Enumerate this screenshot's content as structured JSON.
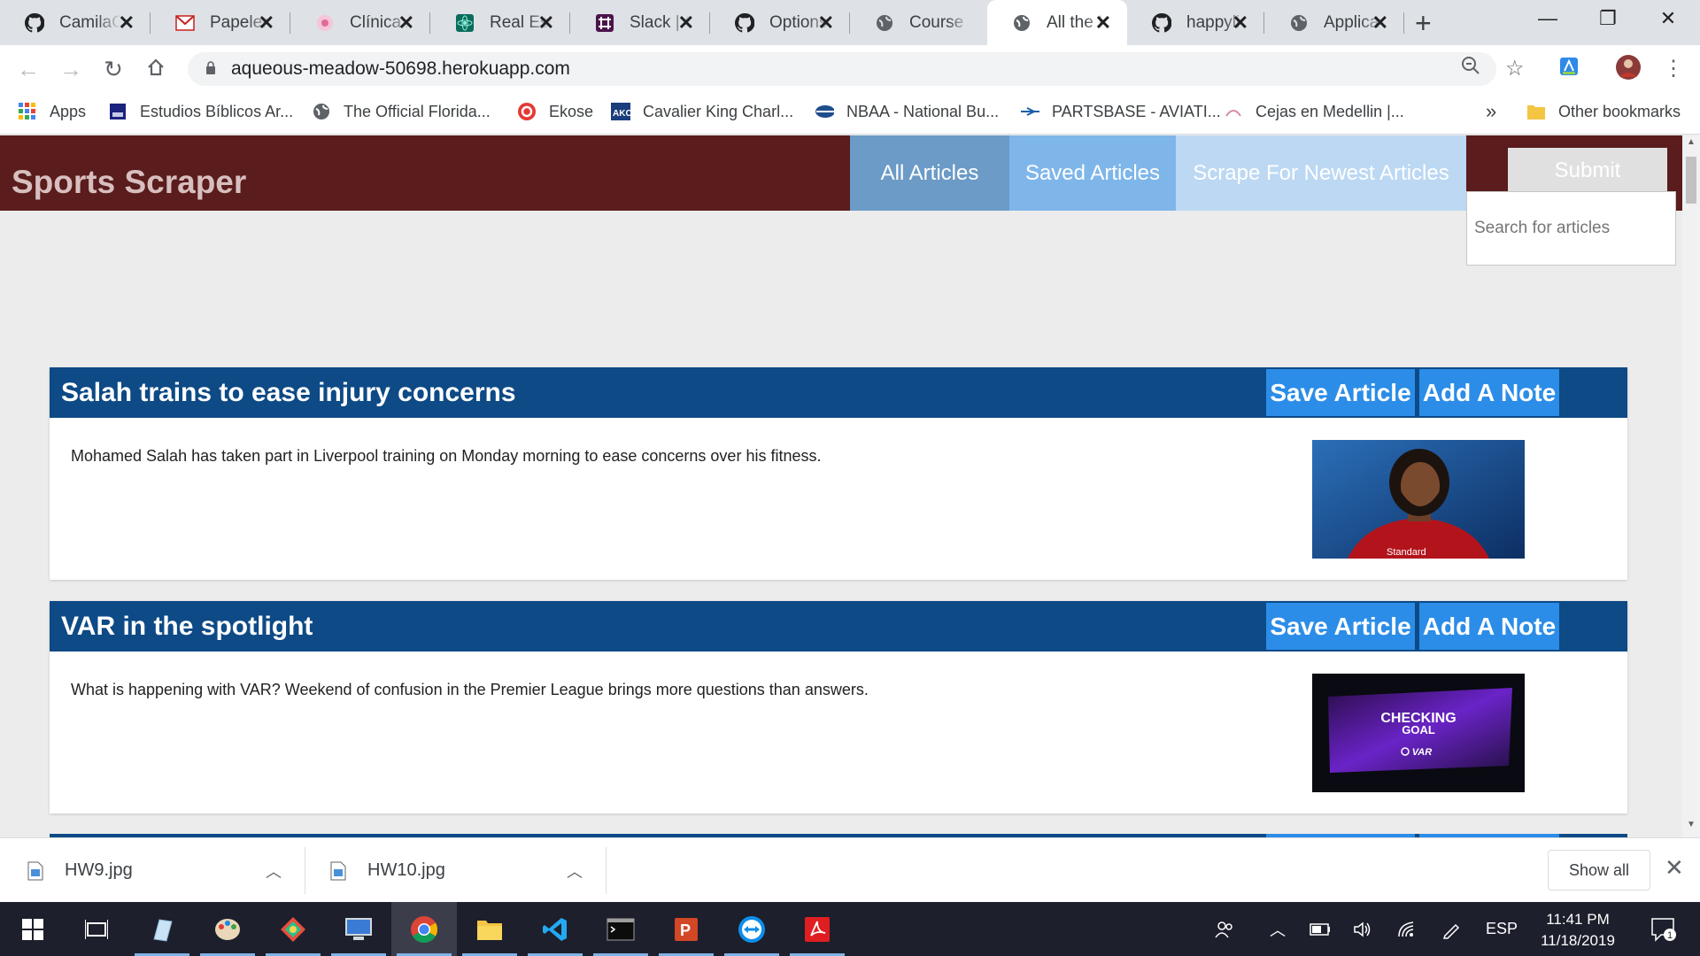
{
  "browser": {
    "tabs": [
      {
        "title": "CamilaC",
        "icon": "github-icon"
      },
      {
        "title": "Papeler",
        "icon": "gmail-icon"
      },
      {
        "title": "Clínica /",
        "icon": "clinic-icon"
      },
      {
        "title": "Real Est",
        "icon": "react-icon"
      },
      {
        "title": "Slack | C",
        "icon": "slack-icon"
      },
      {
        "title": "Options",
        "icon": "github-icon"
      },
      {
        "title": "Course",
        "icon": "globe-icon"
      },
      {
        "title": "All the I",
        "icon": "globe-icon",
        "active": true
      },
      {
        "title": "happyli",
        "icon": "github-icon"
      },
      {
        "title": "Applica",
        "icon": "globe-icon"
      }
    ],
    "url": "aqueous-meadow-50698.herokuapp.com",
    "bookmarks": [
      {
        "label": "Apps",
        "icon": "apps-grid-icon"
      },
      {
        "label": "Estudios Bíblicos Ar...",
        "icon": "bible-icon"
      },
      {
        "label": "The Official Florida...",
        "icon": "globe-icon"
      },
      {
        "label": "Ekose",
        "icon": "ekose-icon"
      },
      {
        "label": "Cavalier King Charl...",
        "icon": "akc-icon"
      },
      {
        "label": "NBAA - National Bu...",
        "icon": "nbaa-icon"
      },
      {
        "label": "PARTSBASE - AVIATI...",
        "icon": "partsbase-icon"
      },
      {
        "label": "Cejas en Medellin |...",
        "icon": "cejas-icon"
      }
    ],
    "bookmarks_overflow": "»",
    "other_bookmarks": "Other bookmarks"
  },
  "site": {
    "brand": "Sports Scraper",
    "nav": {
      "all": "All Articles",
      "saved": "Saved Articles",
      "scrape": "Scrape For Newest Articles"
    },
    "submit": "Submit",
    "search_placeholder": "Search for articles"
  },
  "articles": [
    {
      "title": "Salah trains to ease injury concerns",
      "summary": "Mohamed Salah has taken part in Liverpool training on Monday morning to ease concerns over his fitness.",
      "save_label": "Save Article",
      "note_label": "Add A Note",
      "image_caption": "Standard"
    },
    {
      "title": "VAR in the spotlight",
      "summary": "What is happening with VAR? Weekend of confusion in the Premier League brings more questions than answers.",
      "save_label": "Save Article",
      "note_label": "Add A Note",
      "image_line1": "CHECKING",
      "image_line2": "GOAL",
      "image_brand": "VAR"
    }
  ],
  "downloads": {
    "items": [
      "HW9.jpg",
      "HW10.jpg"
    ],
    "show_all": "Show all"
  },
  "taskbar": {
    "language": "ESP",
    "time": "11:41 PM",
    "date": "11/18/2019",
    "notification_count": "1"
  },
  "colors": {
    "header_bg": "#5a1c1c",
    "card_header": "#0d4a86",
    "button_blue": "#2b8de8"
  }
}
